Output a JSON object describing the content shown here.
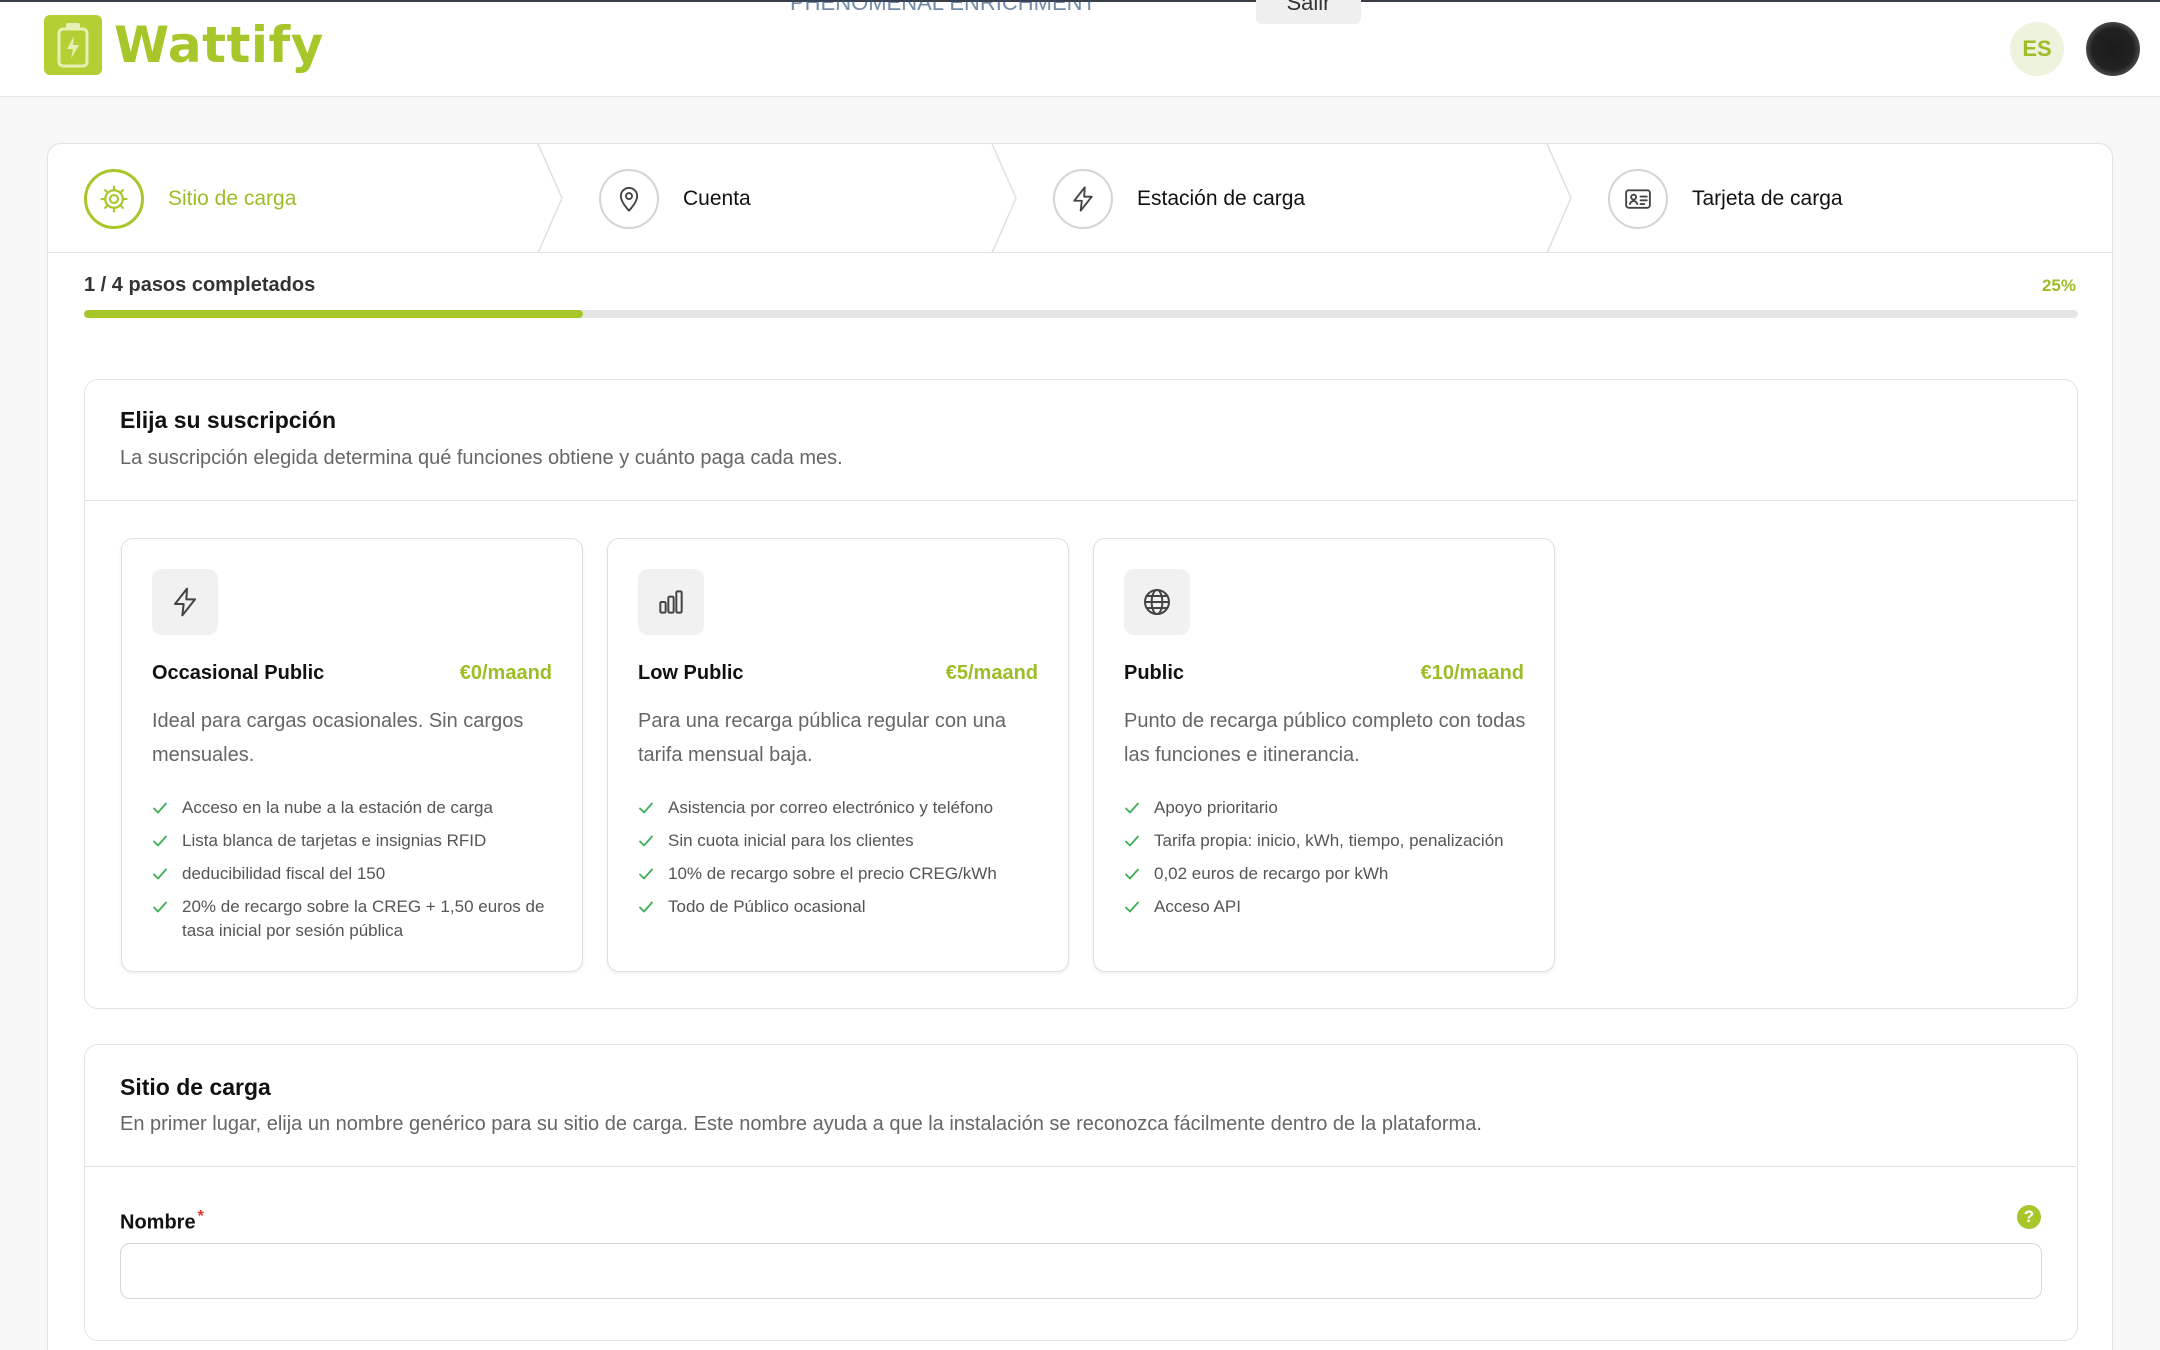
{
  "app": {
    "name": "Wattify"
  },
  "header": {
    "overlay_text": "PHENOMENAL ENRICHMENT",
    "overlay_button": "Salir",
    "language": "ES"
  },
  "stepper": {
    "steps": [
      {
        "label": "Sitio de carga",
        "icon": "gear-icon",
        "active": true
      },
      {
        "label": "Cuenta",
        "icon": "location-pin-icon",
        "active": false
      },
      {
        "label": "Estación de carga",
        "icon": "lightning-icon",
        "active": false
      },
      {
        "label": "Tarjeta de carga",
        "icon": "id-card-icon",
        "active": false
      }
    ]
  },
  "progress": {
    "text": "1 / 4 pasos completados",
    "percent_label": "25%",
    "fraction": 0.25
  },
  "subscription": {
    "title": "Elija su suscripción",
    "description": "La suscripción elegida determina qué funciones obtiene y cuánto paga cada mes.",
    "plans": [
      {
        "name": "Occasional Public",
        "price": "€0/maand",
        "icon": "lightning-icon",
        "description": "Ideal para cargas ocasionales. Sin cargos mensuales.",
        "features": [
          "Acceso en la nube a la estación de carga",
          "Lista blanca de tarjetas e insignias RFID",
          "deducibilidad fiscal del 150",
          "20% de recargo sobre la CREG + 1,50 euros de tasa inicial por sesión pública"
        ]
      },
      {
        "name": "Low Public",
        "price": "€5/maand",
        "icon": "bar-chart-icon",
        "description": "Para una recarga pública regular con una tarifa mensual baja.",
        "features": [
          "Asistencia por correo electrónico y teléfono",
          "Sin cuota inicial para los clientes",
          "10% de recargo sobre el precio CREG/kWh",
          "Todo de Público ocasional"
        ]
      },
      {
        "name": "Public",
        "price": "€10/maand",
        "icon": "globe-icon",
        "description": "Punto de recarga público completo con todas las funciones e itinerancia.",
        "features": [
          "Apoyo prioritario",
          "Tarifa propia: inicio, kWh, tiempo, penalización",
          "0,02 euros de recargo por kWh",
          "Acceso API"
        ]
      }
    ]
  },
  "site": {
    "title": "Sitio de carga",
    "description": "En primer lugar, elija un nombre genérico para su sitio de carga. Este nombre ayuda a que la instalación se reconozca fácilmente dentro de la plataforma.",
    "name_field": {
      "label": "Nombre",
      "required_mark": "*",
      "value": "",
      "help": "?"
    }
  },
  "colors": {
    "accent": "#a7c62a",
    "check": "#3fae5a"
  }
}
